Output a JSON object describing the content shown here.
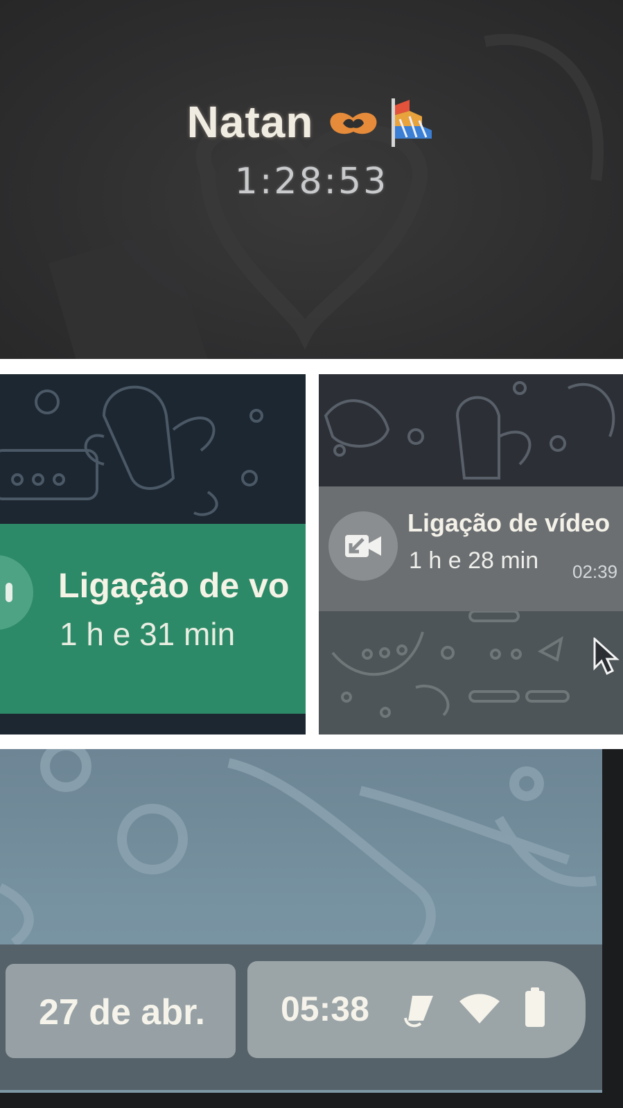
{
  "call_screen": {
    "contact_name": "Natan",
    "emoji_1": "heart-hands-emoji",
    "emoji_2": "rainbow-flag-emoji",
    "call_timer": "1:28:53"
  },
  "voice_call_message": {
    "title": "Ligação de vo",
    "duration": "1 h e 31 min",
    "icon": "phone-call-icon",
    "bubble_color": "#2d8a68"
  },
  "video_call_message": {
    "title": "Ligação de vídeo",
    "duration": "1 h e 28 min",
    "time": "02:39",
    "icon": "missed-video-call-icon",
    "bubble_color": "#6b6f72"
  },
  "status_bar": {
    "date": "27 de abr.",
    "clock": "05:38",
    "icons": [
      "data-saver-icon",
      "wifi-icon",
      "battery-icon"
    ]
  }
}
